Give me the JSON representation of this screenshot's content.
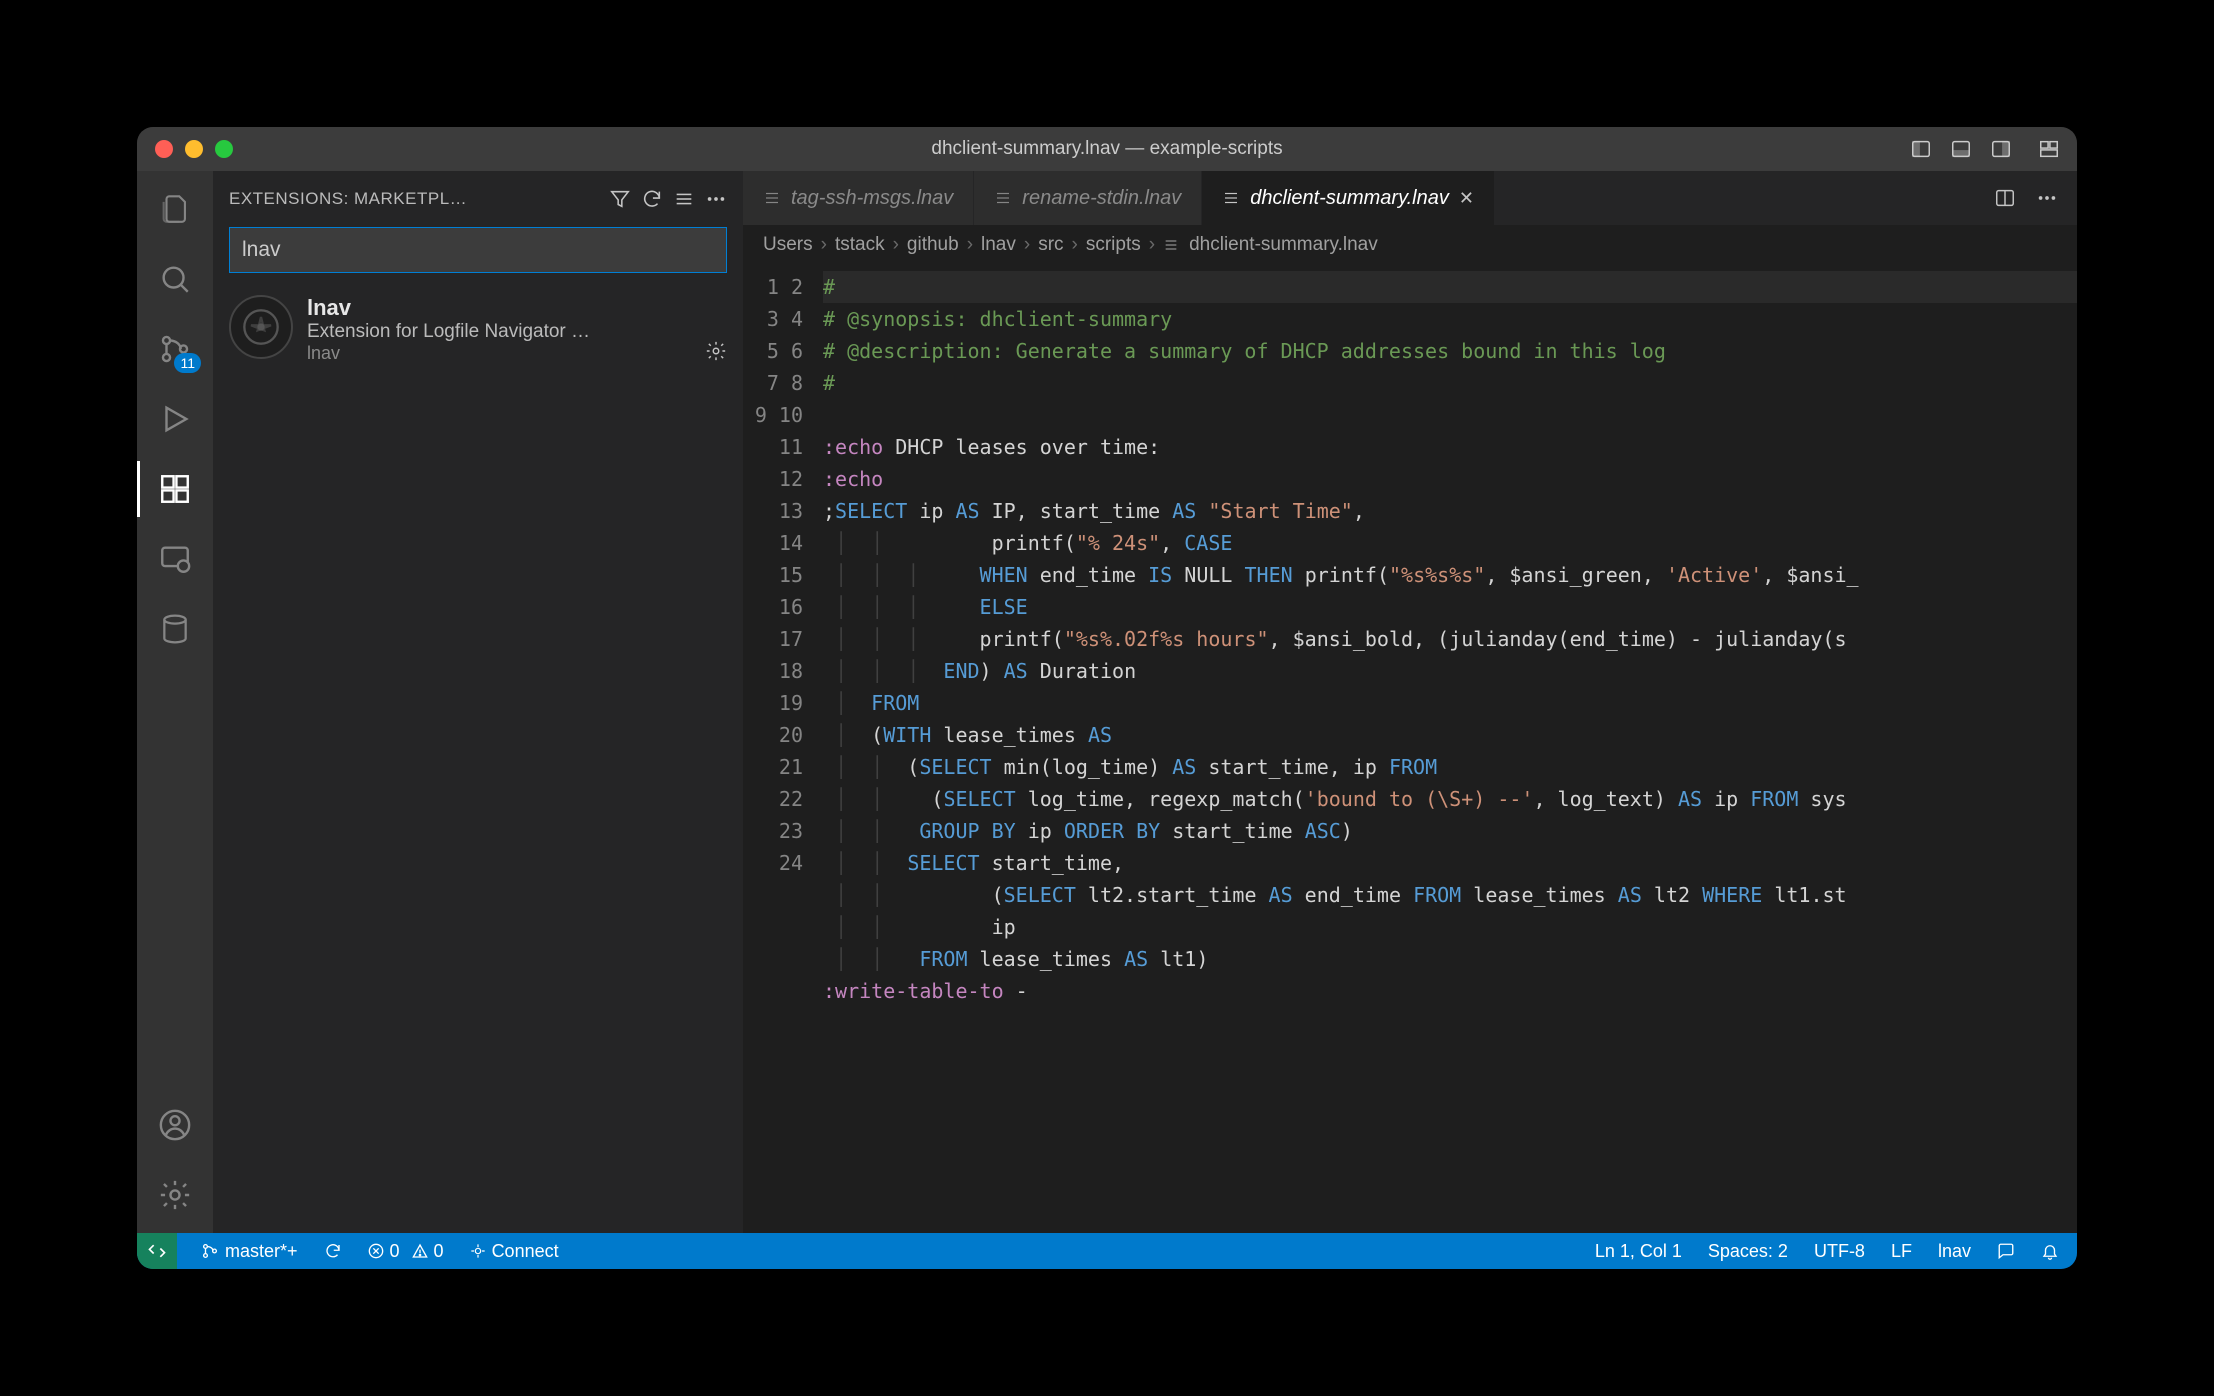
{
  "title": "dhclient-summary.lnav — example-scripts",
  "activitybar": {
    "badge_scm": "11"
  },
  "sidebar": {
    "header_title": "EXTENSIONS: MARKETPL…",
    "search_value": "lnav",
    "ext": {
      "name": "lnav",
      "desc": "Extension for Logfile Navigator …",
      "publisher": "lnav"
    }
  },
  "tabs": {
    "t1": "tag-ssh-msgs.lnav",
    "t2": "rename-stdin.lnav",
    "t3": "dhclient-summary.lnav"
  },
  "breadcrumb": {
    "p1": "Users",
    "p2": "tstack",
    "p3": "github",
    "p4": "lnav",
    "p5": "src",
    "p6": "scripts",
    "file": "dhclient-summary.lnav"
  },
  "code": {
    "l1_a": "#",
    "l2_a": "# @synopsis: dhclient-summary",
    "l3_a": "# @description: Generate a summary of DHCP addresses bound in this log",
    "l4_a": "#",
    "l6_cmd": ":echo",
    "l6_txt": " DHCP leases over time:",
    "l7_cmd": ":echo",
    "l8_a": ";",
    "l8_sel": "SELECT",
    "l8_b": " ip ",
    "l8_as1": "AS",
    "l8_c": " IP, start_time ",
    "l8_as2": "AS",
    "l8_d": " ",
    "l8_str": "\"Start Time\"",
    "l8_e": ",",
    "l9_a": "       printf(",
    "l9_str": "\"% 24s\"",
    "l9_b": ", ",
    "l9_case": "CASE",
    "l10_when": "WHEN",
    "l10_a": " end_time ",
    "l10_is": "IS",
    "l10_null": " NULL ",
    "l10_then": "THEN",
    "l10_b": " printf(",
    "l10_str": "\"%s%s%s\"",
    "l10_c": ", $ansi_green, ",
    "l10_str2": "'Active'",
    "l10_d": ", $ansi_",
    "l11_else": "ELSE",
    "l12_a": "printf(",
    "l12_str": "\"%s%.02f%s hours\"",
    "l12_b": ", $ansi_bold, (julianday(end_time) - julianday(s",
    "l13_end": "END",
    "l13_a": ") ",
    "l13_as": "AS",
    "l13_b": " Duration",
    "l14_from": "FROM",
    "l15_a": " (",
    "l15_with": "WITH",
    "l15_b": " lease_times ",
    "l15_as": "AS",
    "l16_a": "  (",
    "l16_sel": "SELECT",
    "l16_b": " min(log_time) ",
    "l16_as": "AS",
    "l16_c": " start_time, ip ",
    "l16_from": "FROM",
    "l17_a": "    (",
    "l17_sel": "SELECT",
    "l17_b": " log_time, regexp_match(",
    "l17_str": "'bound to (\\S+) --'",
    "l17_c": ", log_text) ",
    "l17_as": "AS",
    "l17_d": " ip ",
    "l17_from": "FROM",
    "l17_e": " sys",
    "l18_a": "   ",
    "l18_grp": "GROUP",
    "l18_by1": " BY",
    "l18_b": " ip ",
    "l18_ord": "ORDER",
    "l18_by2": " BY",
    "l18_c": " start_time ",
    "l18_asc": "ASC",
    "l18_d": ")",
    "l19_a": "  ",
    "l19_sel": "SELECT",
    "l19_b": " start_time,",
    "l20_a": "         (",
    "l20_sel": "SELECT",
    "l20_b": " lt2.start_time ",
    "l20_as": "AS",
    "l20_c": " end_time ",
    "l20_from": "FROM",
    "l20_d": " lease_times ",
    "l20_as2": "AS",
    "l20_e": " lt2 ",
    "l20_where": "WHERE",
    "l20_f": " lt1.st",
    "l21_a": "         ip",
    "l22_a": "   ",
    "l22_from": "FROM",
    "l22_b": " lease_times ",
    "l22_as": "AS",
    "l22_c": " lt1)",
    "l23_cmd": ":write-table-to",
    "l23_a": " -"
  },
  "status": {
    "branch": "master*+",
    "errors": "0",
    "warnings": "0",
    "connect": "Connect",
    "lncol": "Ln 1, Col 1",
    "spaces": "Spaces: 2",
    "encoding": "UTF-8",
    "eol": "LF",
    "lang": "lnav"
  }
}
